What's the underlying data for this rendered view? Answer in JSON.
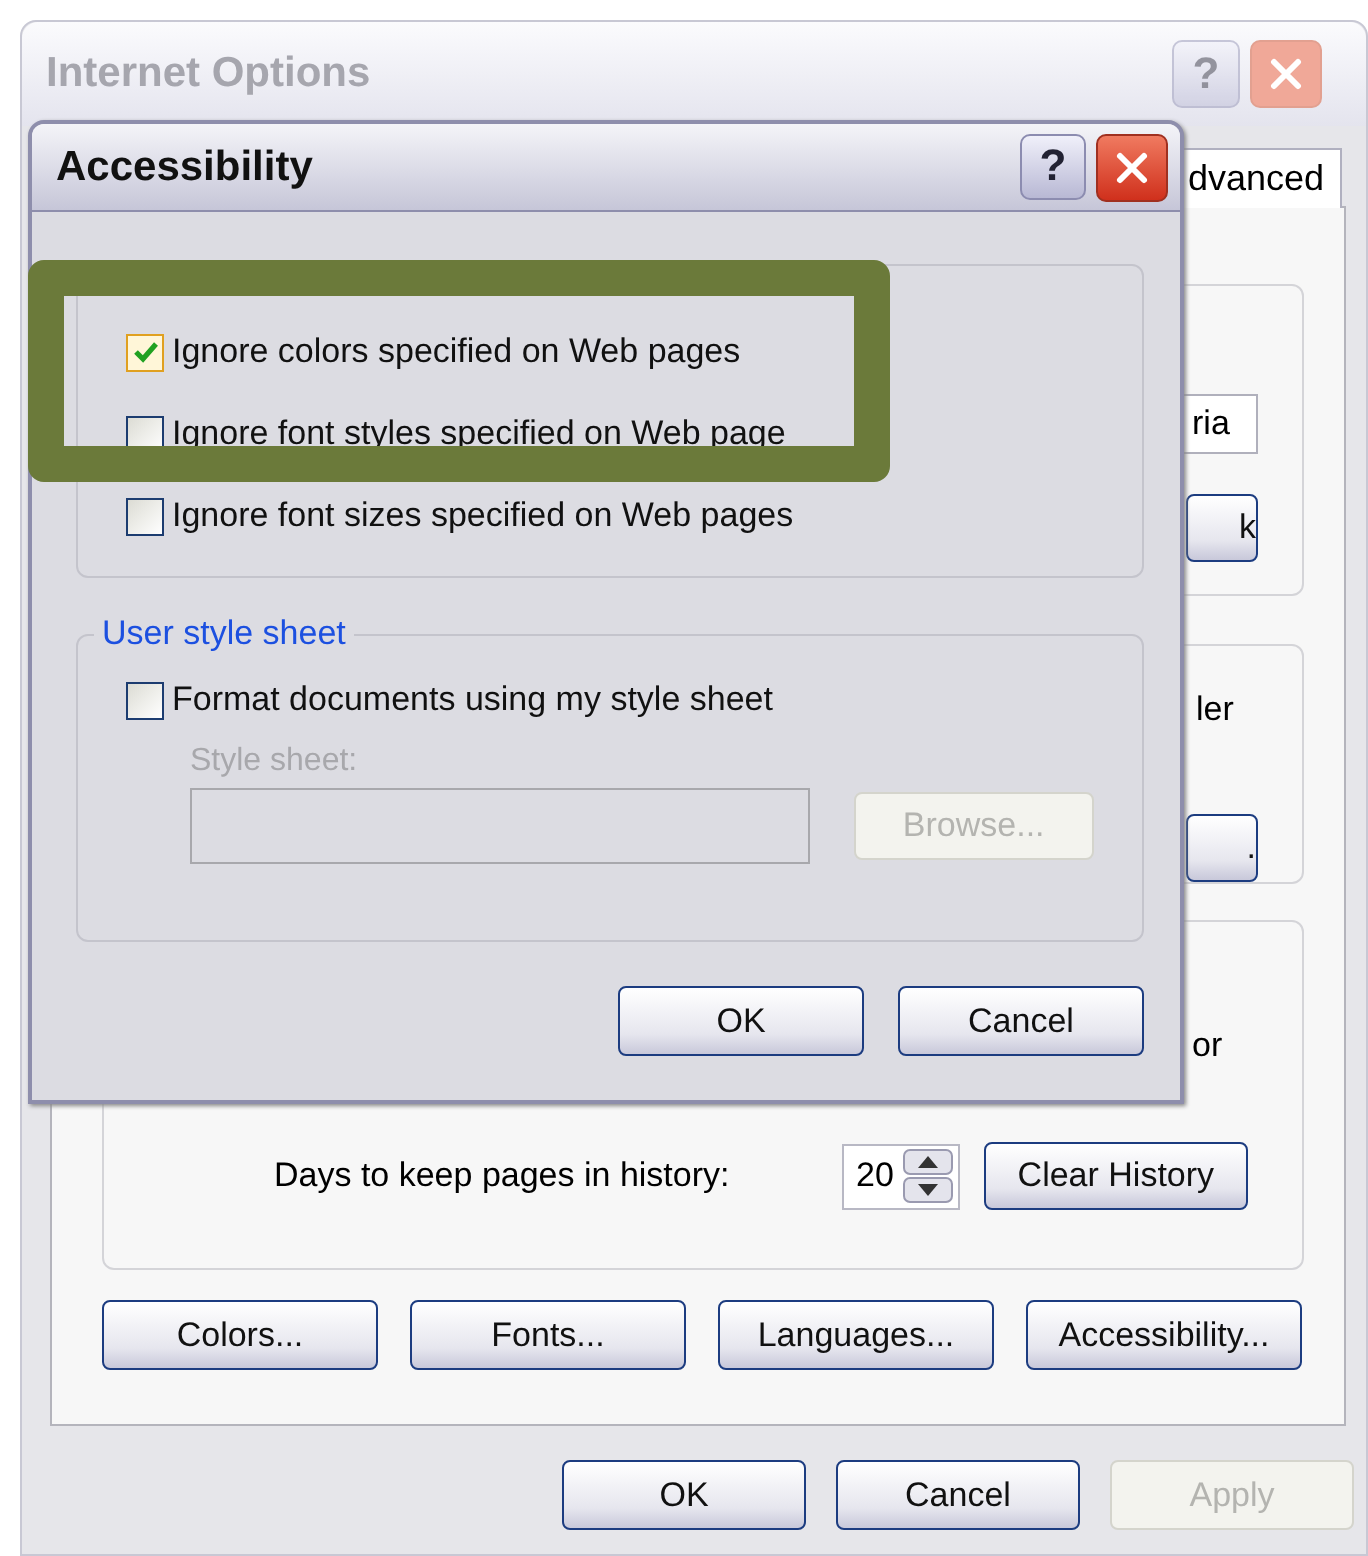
{
  "main_window": {
    "title": "Internet Options",
    "help": "?",
    "active": false,
    "tabs": [
      {
        "label": "dvanced",
        "selected": false
      }
    ],
    "covered_parts": [
      {
        "kind": "field",
        "text": "ria"
      },
      {
        "kind": "button",
        "text": "k"
      },
      {
        "kind": "label",
        "text": "ler"
      },
      {
        "kind": "button",
        "text": "."
      },
      {
        "kind": "label",
        "text": "or"
      }
    ],
    "history": {
      "label": "Days to keep pages in history:",
      "days": "20",
      "button": "Clear History"
    },
    "appearance_buttons": [
      "Colors...",
      "Fonts...",
      "Languages...",
      "Accessibility..."
    ],
    "buttons": [
      {
        "label": "OK",
        "disabled": false
      },
      {
        "label": "Cancel",
        "disabled": false
      },
      {
        "label": "Apply",
        "disabled": true
      }
    ]
  },
  "dialog": {
    "title": "Accessibility",
    "help": "?",
    "active": true,
    "formatting": {
      "options": [
        {
          "label": "Ignore colors specified on Web pages",
          "checked": true
        },
        {
          "label": "Ignore font styles specified on Web page",
          "checked": false
        },
        {
          "label": "Ignore font sizes specified on Web pages",
          "checked": false
        }
      ]
    },
    "user_style_sheet": {
      "legend": "User style sheet",
      "option": {
        "label": "Format documents using my style sheet",
        "checked": false
      },
      "field_label": "Style sheet:",
      "field_disabled": true,
      "browse": {
        "label": "Browse...",
        "disabled": true
      }
    },
    "buttons": [
      {
        "label": "OK",
        "disabled": false
      },
      {
        "label": "Cancel",
        "disabled": false
      }
    ]
  }
}
